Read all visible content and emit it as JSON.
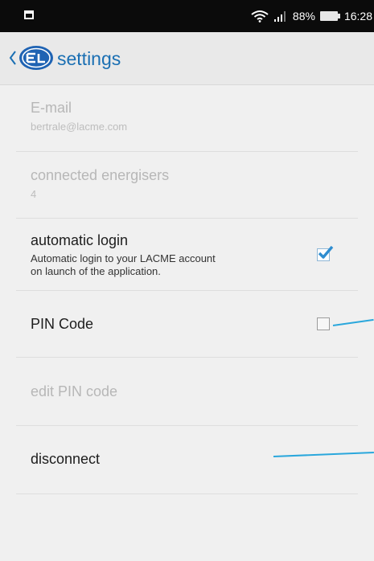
{
  "status_bar": {
    "battery": "88%",
    "time": "16:28"
  },
  "action_bar": {
    "title": "settings",
    "back_icon": "chevron-left-icon",
    "logo_icon": "app-logo-icon"
  },
  "settings": {
    "email": {
      "title": "E-mail",
      "summary": "bertrale@lacme.com"
    },
    "connected_energisers": {
      "title": "connected energisers",
      "summary": "4"
    },
    "automatic_login": {
      "title": "automatic login",
      "summary_line1": "Automatic login to your LACME account",
      "summary_line2": "on launch of the application.",
      "checked": true
    },
    "pin_code": {
      "title": "PIN Code",
      "checked": false
    },
    "edit_pin_code": {
      "title": "edit PIN code"
    },
    "disconnect": {
      "title": "disconnect"
    }
  },
  "colors": {
    "status_bar": "#0b0b0b",
    "action_bar": "#e9e9e9",
    "background": "#f0f0f0",
    "accent": "#1a6fb3",
    "annotation": "#2aa7dc"
  }
}
